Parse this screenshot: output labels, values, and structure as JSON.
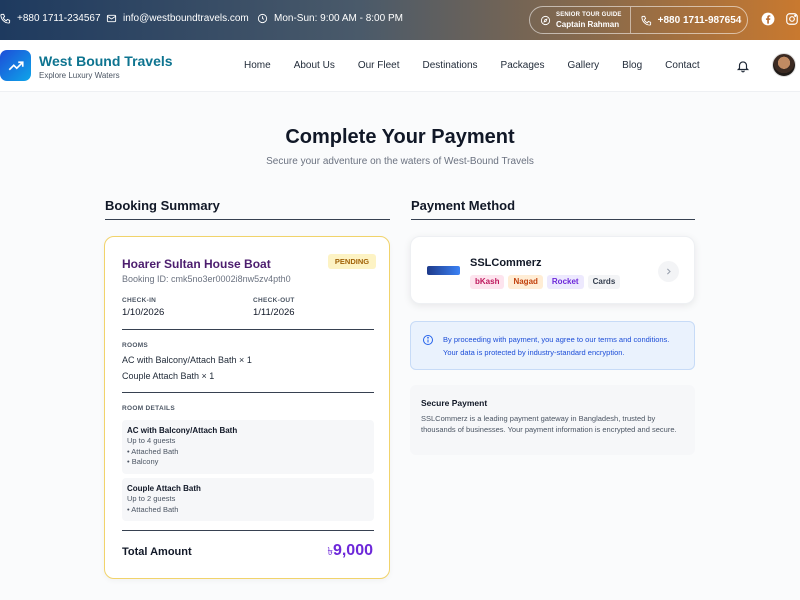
{
  "topbar": {
    "phone": "+880 1711-234567",
    "email": "info@westboundtravels.com",
    "hours": "Mon-Sun: 9:00 AM - 8:00 PM",
    "guide_role": "SENIOR TOUR GUIDE",
    "guide_name": "Captain Rahman",
    "guide_phone": "+880 1711-987654"
  },
  "header": {
    "brand_name": "West Bound Travels",
    "brand_tagline": "Explore Luxury Waters",
    "nav": [
      "Home",
      "About Us",
      "Our Fleet",
      "Destinations",
      "Packages",
      "Gallery",
      "Blog",
      "Contact"
    ]
  },
  "page": {
    "title": "Complete Your Payment",
    "subtitle": "Secure your adventure on the waters of West-Bound Travels"
  },
  "booking": {
    "section_title": "Booking Summary",
    "name": "Hoarer Sultan House Boat",
    "status": "PENDING",
    "booking_id": "Booking ID: cmk5no3er0002i8nw5zv4pth0",
    "checkin_label": "CHECK-IN",
    "checkin_value": "1/10/2026",
    "checkout_label": "CHECK-OUT",
    "checkout_value": "1/11/2026",
    "rooms_label": "ROOMS",
    "rooms": [
      "AC with Balcony/Attach Bath × 1",
      "Couple Attach Bath × 1"
    ],
    "room_details_label": "ROOM DETAILS",
    "room_details": [
      {
        "title": "AC with Balcony/Attach Bath",
        "lines": [
          "Up to 4 guests",
          "• Attached Bath",
          "• Balcony"
        ]
      },
      {
        "title": "Couple Attach Bath",
        "lines": [
          "Up to 2 guests",
          "• Attached Bath"
        ]
      }
    ],
    "total_label": "Total Amount",
    "total_currency": "৳",
    "total_value": "9,000"
  },
  "payment": {
    "section_title": "Payment Method",
    "provider": "SSLCommerz",
    "methods": [
      "bKash",
      "Nagad",
      "Rocket",
      "Cards"
    ],
    "notice_line1": "By proceeding with payment, you agree to our terms and conditions.",
    "notice_line2": "Your data is protected by industry-standard encryption.",
    "secure_title": "Secure Payment",
    "secure_text": "SSLCommerz is a leading payment gateway in Bangladesh, trusted by thousands of businesses. Your payment information is encrypted and secure."
  },
  "colors": {
    "accent_purple": "#6d28d9",
    "brand_teal": "#0e7490",
    "pending_bg": "#fdf3c4"
  },
  "icons": [
    "phone-icon",
    "mail-icon",
    "clock-icon",
    "compass-icon",
    "facebook-icon",
    "instagram-icon",
    "trend-logo-icon",
    "bell-icon",
    "info-icon",
    "chevron-right-icon"
  ]
}
